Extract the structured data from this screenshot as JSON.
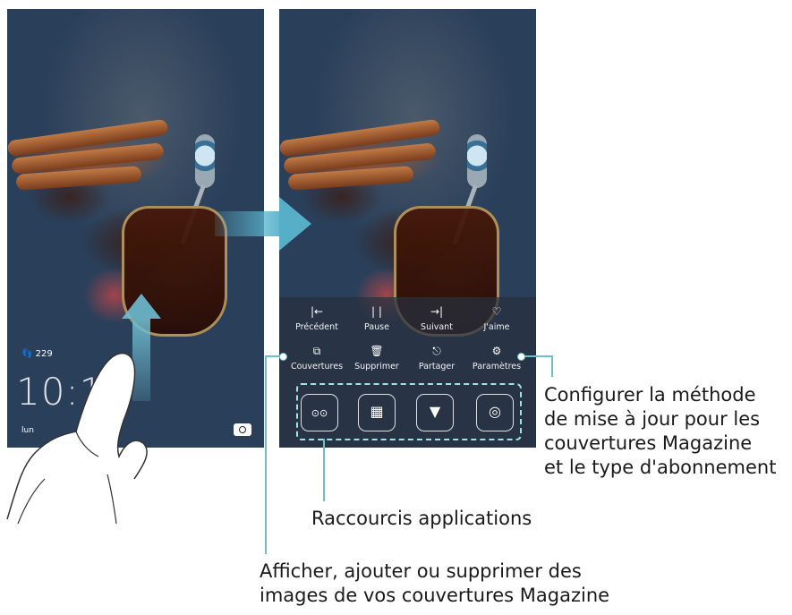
{
  "left_phone": {
    "steps": "229",
    "clock": "10:17",
    "date": "lun"
  },
  "right_phone": {
    "controls_row1": [
      {
        "icon": "previous-icon",
        "glyph": "|←",
        "label": "Précédent"
      },
      {
        "icon": "pause-icon",
        "glyph": "| |",
        "label": "Pause"
      },
      {
        "icon": "next-icon",
        "glyph": "→|",
        "label": "Suivant"
      },
      {
        "icon": "heart-icon",
        "glyph": "♡",
        "label": "J'aime"
      }
    ],
    "controls_row2": [
      {
        "icon": "covers-icon",
        "glyph": "⧉",
        "label": "Couvertures"
      },
      {
        "icon": "trash-icon",
        "glyph": "🗑",
        "label": "Supprimer"
      },
      {
        "icon": "share-icon",
        "glyph": "⎋",
        "label": "Partager"
      },
      {
        "icon": "gear-icon",
        "glyph": "⚙",
        "label": "Paramètres"
      }
    ],
    "shortcuts": [
      {
        "icon": "recorder-icon",
        "glyph": "⊙⊙"
      },
      {
        "icon": "calculator-icon",
        "glyph": "▦"
      },
      {
        "icon": "flashlight-icon",
        "glyph": "▼"
      },
      {
        "icon": "camera-icon",
        "glyph": "◎"
      }
    ]
  },
  "callouts": {
    "settings": [
      "Configurer la méthode",
      "de mise à jour pour les",
      "couvertures Magazine",
      "et le type d'abonnement"
    ],
    "shortcuts": "Raccourcis applications",
    "covers": [
      "Afficher, ajouter ou supprimer des",
      "images de vos couvertures Magazine"
    ]
  },
  "colors": {
    "accent": "#6fbfc4",
    "arrow": "#5ab4cd"
  }
}
